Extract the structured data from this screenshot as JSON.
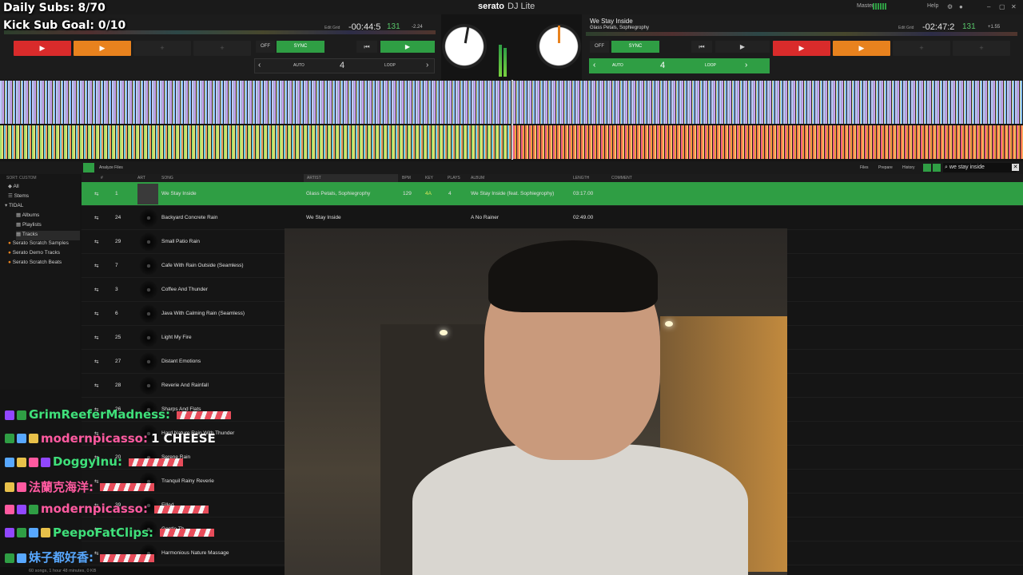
{
  "overlay": {
    "daily_subs": "Daily Subs: 8/70",
    "kick_goal": "Kick Sub Goal: 0/10"
  },
  "app": {
    "brand": "serato",
    "product": "DJ Lite",
    "master_label": "Master",
    "help_label": "Help"
  },
  "deck_left": {
    "remaining": "-00:44:5",
    "bpm": "131",
    "pitch": "-2.24",
    "edit_grid": "Edit Grid",
    "sync_label": "SYNC",
    "off_label": "OFF",
    "auto_label": "AUTO",
    "loop_size": "4",
    "loop_label": "LOOP",
    "cue_play": "▶",
    "cue_add": "+"
  },
  "deck_right": {
    "title": "We Stay Inside",
    "artist": "Glass Petals, Sophiegrophy",
    "remaining": "-02:47:2",
    "bpm": "131",
    "pitch": "+1.55",
    "edit_grid": "Edit Grid",
    "sync_label": "SYNC",
    "off_label": "OFF",
    "auto_label": "AUTO",
    "loop_size": "4",
    "loop_label": "LOOP",
    "cue_play": "▶",
    "cue_add": "+"
  },
  "library": {
    "analyze_label": "Analyze Files",
    "files_label": "Files",
    "prepare_label": "Prepare",
    "history_label": "History",
    "search_value": "we stay inside",
    "columns": [
      "#",
      "ART",
      "SONG",
      "ARTIST",
      "BPM",
      "KEY",
      "PLAYS",
      "ALBUM",
      "LENGTH",
      "COMMENT"
    ],
    "sidebar": {
      "sort_label": "SORT: CUSTOM",
      "items": [
        "All",
        "Stems",
        "TIDAL",
        "Albums",
        "Playlists",
        "Tracks",
        "Serato Scratch Samples",
        "Serato Demo Tracks",
        "Serato Scratch Beats"
      ]
    },
    "rows": [
      {
        "num": "1",
        "song": "We Stay Inside",
        "artist": "Glass Petals, Sophiegrophy",
        "bpm": "129",
        "key": "4A",
        "plays": "4",
        "album": "We Stay Inside (feat. Sophiegrophy)",
        "length": "03:17.00"
      },
      {
        "num": "24",
        "song": "Backyard Concrete Rain",
        "artist": "We Stay Inside",
        "bpm": "",
        "key": "",
        "plays": "",
        "album": "A No Rainer",
        "length": "02:49.00"
      },
      {
        "num": "29",
        "song": "Small Patio Rain",
        "artist": "",
        "bpm": "",
        "key": "",
        "plays": "",
        "album": "",
        "length": ""
      },
      {
        "num": "7",
        "song": "Cafe With Rain Outside (Seamless)",
        "artist": "",
        "bpm": "",
        "key": "",
        "plays": "",
        "album": "",
        "length": ""
      },
      {
        "num": "3",
        "song": "Coffee And Thunder",
        "artist": "",
        "bpm": "",
        "key": "",
        "plays": "",
        "album": "",
        "length": ""
      },
      {
        "num": "6",
        "song": "Java With Calming Rain (Seamless)",
        "artist": "",
        "bpm": "",
        "key": "",
        "plays": "",
        "album": "",
        "length": ""
      },
      {
        "num": "25",
        "song": "Light My Fire",
        "artist": "",
        "bpm": "",
        "key": "",
        "plays": "",
        "album": "",
        "length": ""
      },
      {
        "num": "27",
        "song": "Distant Emotions",
        "artist": "",
        "bpm": "",
        "key": "",
        "plays": "",
        "album": "",
        "length": ""
      },
      {
        "num": "28",
        "song": "Reverie And Rainfall",
        "artist": "",
        "bpm": "",
        "key": "",
        "plays": "",
        "album": "",
        "length": ""
      },
      {
        "num": "26",
        "song": "Sharps And Flats",
        "artist": "",
        "bpm": "",
        "key": "",
        "plays": "",
        "album": "",
        "length": ""
      },
      {
        "num": "",
        "song": "Hard Nature Rain With Thunder",
        "artist": "",
        "bpm": "",
        "key": "",
        "plays": "",
        "album": "",
        "length": ""
      },
      {
        "num": "20",
        "song": "Serene Rain",
        "artist": "",
        "bpm": "",
        "key": "",
        "plays": "",
        "album": "",
        "length": ""
      },
      {
        "num": "",
        "song": "Tranquil Rainy Reverie",
        "artist": "",
        "bpm": "",
        "key": "",
        "plays": "",
        "album": "",
        "length": ""
      },
      {
        "num": "39",
        "song": "Filled",
        "artist": "",
        "bpm": "",
        "key": "",
        "plays": "",
        "album": "",
        "length": ""
      },
      {
        "num": "",
        "song": "Gentle Th",
        "artist": "",
        "bpm": "",
        "key": "",
        "plays": "",
        "album": "",
        "length": ""
      },
      {
        "num": "",
        "song": "Harmonious Nature Massage",
        "artist": "",
        "bpm": "",
        "key": "",
        "plays": "",
        "album": "",
        "length": ""
      }
    ],
    "status": "60 songs, 1 hour 48 minutes, 0 KB"
  },
  "chat": [
    {
      "user": "GrimReeferMadness:",
      "msg": "",
      "color": "#3fe07a"
    },
    {
      "user": "modernpicasso:",
      "msg": "1 CHEESE",
      "color": "#ff5aa0"
    },
    {
      "user": "DoggyInu:",
      "msg": "",
      "color": "#3fe07a"
    },
    {
      "user": "法蘭克海洋:",
      "msg": "",
      "color": "#ff5aa0"
    },
    {
      "user": "modernpicasso:",
      "msg": "",
      "color": "#ff5aa0"
    },
    {
      "user": "PeepoFatClips:",
      "msg": "",
      "color": "#3fe07a"
    },
    {
      "user": "妹子都好香:",
      "msg": "",
      "color": "#58a8ff"
    }
  ],
  "colors": {
    "accent": "#2f9e44",
    "cue_red": "#d92b2b",
    "cue_orange": "#e8821e"
  }
}
